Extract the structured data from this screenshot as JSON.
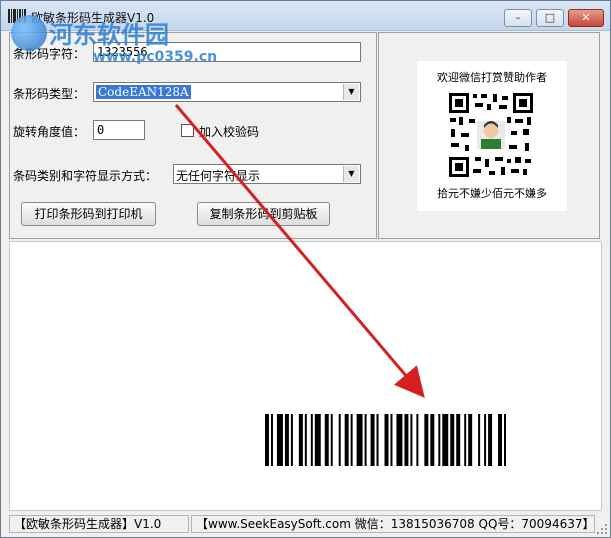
{
  "window": {
    "title": "欧敏条形码生成器V1.0",
    "minimize_glyph": "–",
    "maximize_glyph": "□",
    "close_glyph": "✕"
  },
  "watermark": {
    "title": "河东软件园",
    "url": "www.pc0359.cn"
  },
  "form": {
    "barcode_string_label": "条形码字符：",
    "barcode_string_value": "1323556",
    "barcode_type_label": "条形码类型：",
    "barcode_type_value": "CodeEAN128A",
    "rotation_label": "旋转角度值：",
    "rotation_value": "0",
    "checksum_label": "加入校验码",
    "display_mode_label": "条码类别和字符显示方式：",
    "display_mode_value": "无任何字符显示",
    "print_button": "打印条形码到打印机",
    "copy_button": "复制条形码到剪贴板"
  },
  "donation": {
    "top_text": "欢迎微信打赏赞助作者",
    "bottom_text": "拾元不嫌少佰元不嫌多"
  },
  "status": {
    "app_name": "【欧敏条形码生成器】V1.0",
    "contact": "【www.SeekEasySoft.com 微信：13815036708 QQ号：70094637】"
  },
  "colors": {
    "arrow": "#d42020",
    "selection": "#3a78d6",
    "watermark": "#2b7fd6"
  },
  "icons": {
    "app": "barcode-icon",
    "combo": "chevron-down-icon",
    "qr": "qr-code-icon"
  }
}
